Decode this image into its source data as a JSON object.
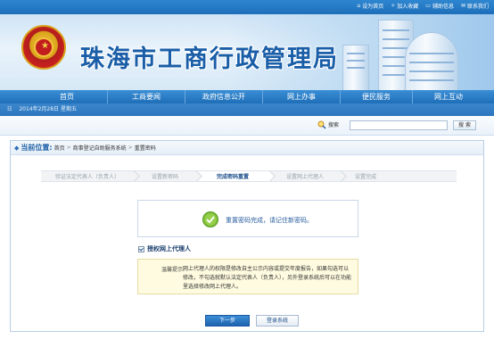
{
  "topbar": {
    "links": [
      {
        "icon": "home-icon",
        "label": "设为首页"
      },
      {
        "icon": "star-icon",
        "label": "加入收藏"
      },
      {
        "icon": "help-icon",
        "label": "辅助信息"
      },
      {
        "icon": "mail-icon",
        "label": "联系我们"
      }
    ]
  },
  "banner": {
    "title": "珠海市工商行政管理局"
  },
  "nav": {
    "items": [
      "首页",
      "工商要闻",
      "政府信息公开",
      "网上办事",
      "便民服务",
      "网上互动"
    ]
  },
  "datebar": {
    "date": "2014年2月28日 星期五"
  },
  "search": {
    "label": "搜索",
    "button": "搜 索",
    "value": ""
  },
  "breadcrumb": {
    "lead": "当前位置:",
    "items": [
      "首页",
      "商事登记自助服务系统",
      "重置密码"
    ]
  },
  "steps": [
    {
      "label": "验证法定代表人（负责人）",
      "active": false
    },
    {
      "label": "设置新密码",
      "active": false
    },
    {
      "label": "完成密码重置",
      "active": true
    },
    {
      "label": "设置网上代理人",
      "active": false
    },
    {
      "label": "设置完成",
      "active": false
    }
  ],
  "success": {
    "message": "重置密码完成，请记住新密码。"
  },
  "authorize": {
    "label": "授权网上代理人",
    "checked": true
  },
  "tip": {
    "label": "温馨提示:",
    "text": "网上代理人的权限是修改自主公示内容或提交年度报告，如果勾选可以修改，不勾选就默认法定代表人（负责人），另外登录系统后可以在功能里选择修改网上代理人。"
  },
  "buttons": {
    "next": "下一步",
    "login": "登录系统"
  },
  "colors": {
    "nav_blue": "#1f6fb8",
    "title_blue": "#1a5ea8",
    "tip_bg": "#fffbe0"
  }
}
